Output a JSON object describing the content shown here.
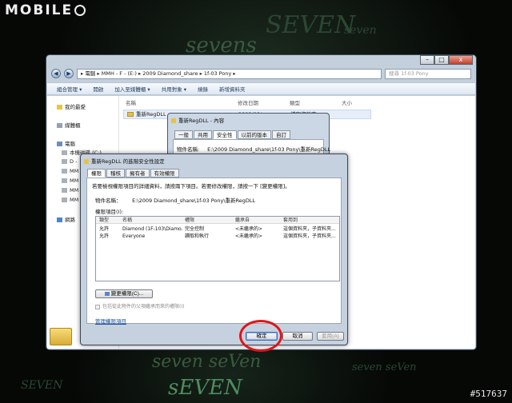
{
  "site": {
    "logo_text": "MOBILE",
    "watermark": "#517637"
  },
  "background": {
    "words": [
      "sevens",
      "SEVEN",
      "seven seVen",
      "seven",
      "SEVEN",
      "seven seVen",
      "sEVEN"
    ]
  },
  "explorer": {
    "breadcrumb": "▸ 電腦 ▸ MMH - F - (E:) ▸ 2009 Diamond_share ▸ 1f-03 Pony ▸",
    "search_placeholder": "搜尋 1f-03 Pony",
    "window_controls": [
      "–",
      "□",
      "x"
    ],
    "toolbar": [
      "組合管理 ▾",
      "開啟",
      "加入至媒體櫃 ▾",
      "共用對象 ▾",
      "燒錄",
      "新增資料夾"
    ],
    "columns": [
      "名稱",
      "修改日期",
      "類型",
      "大小"
    ],
    "file_row": {
      "name": "重新RegDLL",
      "date": "2009/09/..",
      "type": "檔案資料夾"
    },
    "nav": [
      {
        "label": "我的最愛",
        "icon": "star-icon"
      },
      {
        "label": "媒體櫃",
        "icon": "library-icon"
      },
      {
        "label": "電腦",
        "icon": "computer-icon"
      },
      {
        "label": "本機磁碟 (C:)",
        "icon": "drive-icon"
      },
      {
        "label": "D -",
        "icon": "drive-icon"
      },
      {
        "label": "MM",
        "icon": "drive-icon"
      },
      {
        "label": "MM",
        "icon": "drive-icon"
      },
      {
        "label": "MM",
        "icon": "drive-icon"
      },
      {
        "label": "MM",
        "icon": "drive-icon"
      },
      {
        "label": "網路",
        "icon": "network-icon"
      }
    ]
  },
  "props_dialog": {
    "title": "重新RegDLL - 內容",
    "tabs": [
      "一般",
      "共用",
      "安全性",
      "以前的版本",
      "自訂"
    ],
    "active_tab": "安全性",
    "object_label": "物件名稱:",
    "object_value": "E:\\2009 Diamond_share\\1f-03 Pony\\重新RegDLL"
  },
  "adv_dialog": {
    "title": "重新RegDLL 的進階安全性設定",
    "tabs": [
      "權限",
      "稽核",
      "擁有者",
      "有效權限"
    ],
    "active_tab": "權限",
    "info": "若要檢視權限項目的詳細資料，請按兩下項目。若要修改權限，請按一下 [變更權限]。",
    "object_label": "物件名稱：",
    "object_value": "E:\\2009 Diamond_share\\1f-03 Pony\\重新RegDLL",
    "entries_label": "權限項目(I):",
    "headers": [
      "類型",
      "名稱",
      "權限",
      "繼承自",
      "套用到"
    ],
    "rows": [
      [
        "允許",
        "Diamond (1F-103\\Diamo...",
        "完全控制",
        "<未繼承的>",
        "這個資料夾，子資料夾..."
      ],
      [
        "允許",
        "Everyone",
        "讀取和執行",
        "<未繼承的>",
        "這個資料夾，子資料夾..."
      ]
    ],
    "change_button": "變更權限(C)...",
    "inherit_checkbox": "包括從此物件的父項繼承而來的權限(I)",
    "manage_link": "管理權限項目",
    "ok": "確定",
    "cancel": "取消",
    "apply": "套用(A)"
  }
}
